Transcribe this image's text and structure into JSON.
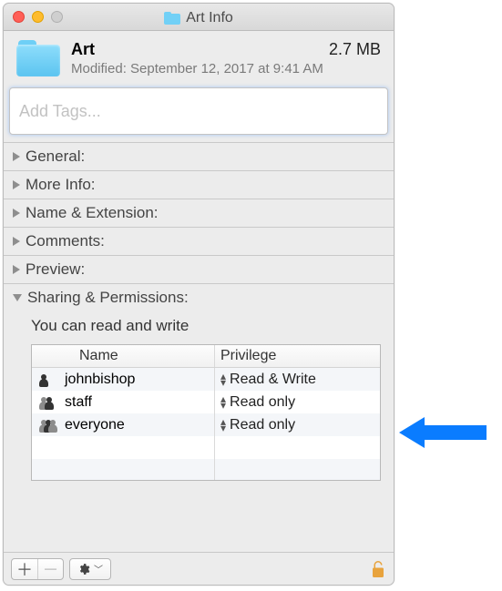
{
  "window": {
    "title": "Art Info"
  },
  "summary": {
    "name": "Art",
    "size": "2.7 MB",
    "modified": "Modified: September 12, 2017 at 9:41 AM"
  },
  "tags": {
    "placeholder": "Add Tags..."
  },
  "sections": {
    "general": "General:",
    "moreinfo": "More Info:",
    "nameext": "Name & Extension:",
    "comments": "Comments:",
    "preview": "Preview:",
    "sharing": "Sharing & Permissions:"
  },
  "permissions": {
    "note": "You can read and write",
    "headers": {
      "name": "Name",
      "priv": "Privilege"
    },
    "rows": [
      {
        "name": "johnbishop",
        "priv": "Read & Write",
        "icon": "single"
      },
      {
        "name": "staff",
        "priv": "Read only",
        "icon": "pair"
      },
      {
        "name": "everyone",
        "priv": "Read only",
        "icon": "group"
      }
    ]
  }
}
